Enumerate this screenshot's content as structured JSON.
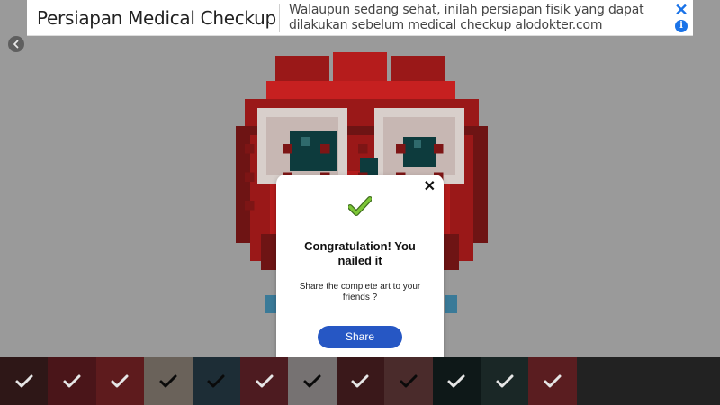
{
  "ad": {
    "title": "Persiapan Medical Checkup",
    "description_line1": "Walaupun sedang sehat, inilah persiapan fisik yang dapat",
    "description_line2": "dilakukan sebelum medical checkup alodokter.com",
    "close_icon": "close-icon",
    "info_icon": "info-icon"
  },
  "back_icon": "chevron-left-icon",
  "dialog": {
    "title": "Congratulation! You nailed it",
    "message": "Share the complete art to your friends ?",
    "share_label": "Share",
    "close_symbol": "✕"
  },
  "palette": {
    "swatches": [
      {
        "color": "#2e1717",
        "check": "white"
      },
      {
        "color": "#4a1519",
        "check": "white"
      },
      {
        "color": "#5e1b1d",
        "check": "white"
      },
      {
        "color": "#6a625a",
        "check": "black"
      },
      {
        "color": "#1d2d36",
        "check": "black"
      },
      {
        "color": "#4d1b20",
        "check": "white"
      },
      {
        "color": "#767272",
        "check": "black"
      },
      {
        "color": "#3a181a",
        "check": "white"
      },
      {
        "color": "#4a2b2b",
        "check": "black"
      },
      {
        "color": "#0e1818",
        "check": "white"
      },
      {
        "color": "#1a2726",
        "check": "white"
      },
      {
        "color": "#5a1d20",
        "check": "white"
      }
    ],
    "tail_color": "#222222"
  },
  "colors": {
    "accent": "#2657c4",
    "check_green": "#7cc636"
  }
}
